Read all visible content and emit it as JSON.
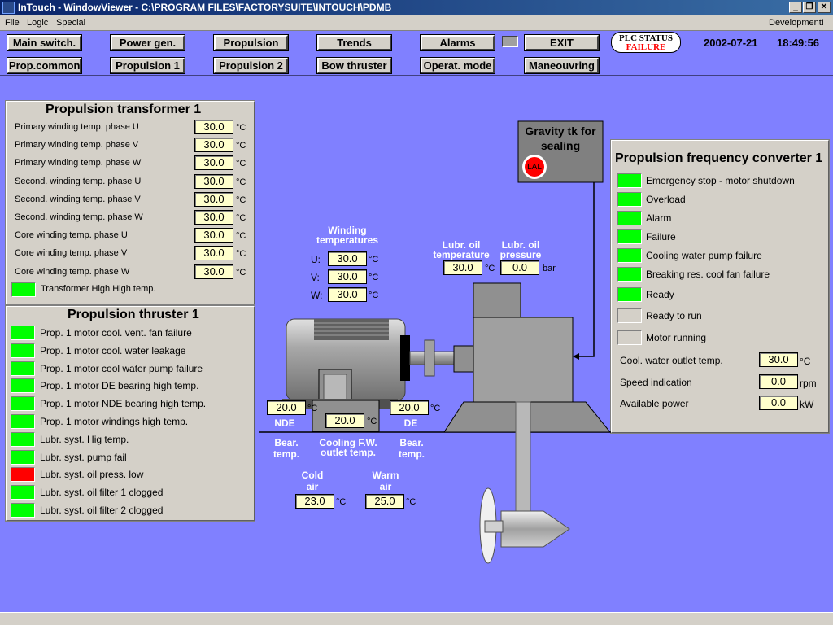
{
  "window": {
    "title": "InTouch - WindowViewer - C:\\PROGRAM FILES\\FACTORYSUITE\\INTOUCH\\PDMB",
    "minimize": "_",
    "restore": "❐",
    "close": "✕"
  },
  "menu": {
    "file": "File",
    "logic": "Logic",
    "special": "Special",
    "development": "Development!"
  },
  "nav_row1": {
    "main_switch": "Main switch.",
    "power_gen": "Power gen.",
    "propulsion": "Propulsion",
    "trends": "Trends",
    "alarms": "Alarms",
    "exit": "EXIT"
  },
  "nav_row2": {
    "prop_common": "Prop.common",
    "propulsion1": "Propulsion 1",
    "propulsion2": "Propulsion 2",
    "bow_thruster": "Bow thruster",
    "operat_mode": "Operat. mode",
    "maneouvring": "Maneouvring"
  },
  "plc": {
    "label": "PLC STATUS",
    "state": "FAILURE"
  },
  "date": "2002-07-21",
  "time": "18:49:56",
  "transformer": {
    "title": "Propulsion transformer 1",
    "rows": [
      {
        "label": "Primary winding temp. phase U",
        "value": "30.0",
        "unit": "°C"
      },
      {
        "label": "Primary winding temp. phase V",
        "value": "30.0",
        "unit": "°C"
      },
      {
        "label": "Primary winding temp. phase W",
        "value": "30.0",
        "unit": "°C"
      },
      {
        "label": "Second. winding temp. phase U",
        "value": "30.0",
        "unit": "°C"
      },
      {
        "label": "Second. winding temp. phase V",
        "value": "30.0",
        "unit": "°C"
      },
      {
        "label": "Second. winding temp. phase W",
        "value": "30.0",
        "unit": "°C"
      },
      {
        "label": "Core winding temp. phase U",
        "value": "30.0",
        "unit": "°C"
      },
      {
        "label": "Core winding temp. phase V",
        "value": "30.0",
        "unit": "°C"
      },
      {
        "label": "Core winding temp. phase W",
        "value": "30.0",
        "unit": "°C"
      }
    ],
    "alarm": {
      "label": "Transformer High High temp.",
      "state": "on"
    }
  },
  "thruster": {
    "title": "Propulsion thruster 1",
    "alarms": [
      {
        "label": "Prop. 1 motor cool. vent. fan failure",
        "state": "on"
      },
      {
        "label": "Prop. 1 motor cool. water leakage",
        "state": "on"
      },
      {
        "label": "Prop. 1 motor cool water pump failure",
        "state": "on"
      },
      {
        "label": "Prop. 1 motor DE bearing high temp.",
        "state": "on"
      },
      {
        "label": "Prop. 1 motor NDE bearing high temp.",
        "state": "on"
      },
      {
        "label": "Prop. 1 motor windings high temp.",
        "state": "on"
      },
      {
        "label": "Lubr. syst. Hig temp.",
        "state": "on"
      },
      {
        "label": "Lubr. syst. pump fail",
        "state": "on"
      },
      {
        "label": "Lubr. syst. oil press. low",
        "state": "alarm"
      },
      {
        "label": "Lubr. syst. oil filter 1 clogged",
        "state": "on"
      },
      {
        "label": "Lubr. syst. oil filter 2 clogged",
        "state": "on"
      }
    ]
  },
  "converter": {
    "title": "Propulsion frequency converter 1",
    "status": [
      {
        "label": "Emergency stop - motor shutdown",
        "state": "on"
      },
      {
        "label": "Overload",
        "state": "on"
      },
      {
        "label": "Alarm",
        "state": "on"
      },
      {
        "label": "Failure",
        "state": "on"
      },
      {
        "label": "Cooling water pump failure",
        "state": "on"
      },
      {
        "label": "Breaking res. cool fan failure",
        "state": "on"
      },
      {
        "label": "Ready",
        "state": "on"
      },
      {
        "label": "Ready to run",
        "state": "off"
      },
      {
        "label": "Motor running",
        "state": "off"
      }
    ],
    "values": [
      {
        "label": "Cool. water outlet temp.",
        "value": "30.0",
        "unit": "°C"
      },
      {
        "label": "Speed indication",
        "value": "0.0",
        "unit": "rpm"
      },
      {
        "label": "Available power",
        "value": "0.0",
        "unit": "kW"
      }
    ]
  },
  "gravity_tank": {
    "title_line1": "Gravity tk for",
    "title_line2": "sealing",
    "indicator": "LAL"
  },
  "winding": {
    "title_line1": "Winding",
    "title_line2": "temperatures",
    "u_label": "U:",
    "u_value": "30.0",
    "v_label": "V:",
    "v_value": "30.0",
    "w_label": "W:",
    "w_value": "30.0",
    "unit": "°C"
  },
  "lubr_temp": {
    "line1": "Lubr. oil",
    "line2": "temperature",
    "value": "30.0",
    "unit": "°C"
  },
  "lubr_press": {
    "line1": "Lubr. oil",
    "line2": "pressure",
    "value": "0.0",
    "unit": "bar"
  },
  "bearing_nde": {
    "value": "20.0",
    "unit": "°C",
    "label": "NDE"
  },
  "bearing_de": {
    "value": "20.0",
    "unit": "°C",
    "label": "DE"
  },
  "bear_temp_label": {
    "line1": "Bear.",
    "line2": "temp."
  },
  "cooling_fw": {
    "value": "20.0",
    "unit": "°C",
    "line1": "Cooling F.W.",
    "line2": "outlet temp."
  },
  "cold_air": {
    "line1": "Cold",
    "line2": "air",
    "value": "23.0",
    "unit": "°C"
  },
  "warm_air": {
    "line1": "Warm",
    "line2": "air",
    "value": "25.0",
    "unit": "°C"
  },
  "colors": {
    "background": "#8080ff",
    "led_on": "#00ff00",
    "led_alarm": "#ff0000",
    "box_fill": "#ffffcc"
  }
}
